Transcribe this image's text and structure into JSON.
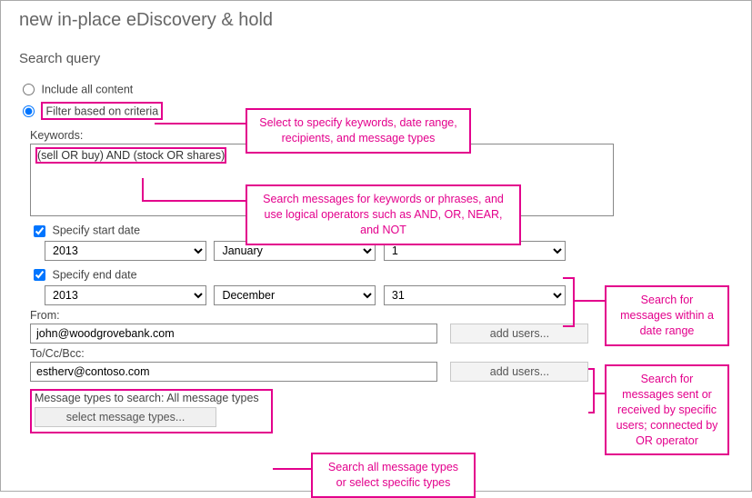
{
  "page_title": "new in-place eDiscovery & hold",
  "section_title": "Search query",
  "radio": {
    "include_all": "Include all content",
    "filter_criteria": "Filter based on criteria"
  },
  "keywords_label": "Keywords:",
  "keywords_value": "(sell OR buy) AND (stock OR shares)",
  "start_date": {
    "label": "Specify start date",
    "year": "2013",
    "month": "January",
    "day": "1"
  },
  "end_date": {
    "label": "Specify end date",
    "year": "2013",
    "month": "December",
    "day": "31"
  },
  "from": {
    "label": "From:",
    "value": "john@woodgrovebank.com",
    "btn": "add users..."
  },
  "tocc": {
    "label": "To/Cc/Bcc:",
    "value": "estherv@contoso.com",
    "btn": "add users..."
  },
  "msg_types": {
    "label": "Message types to search:  All message types",
    "btn": "select message types..."
  },
  "callouts": {
    "criteria": "Select to specify keywords, date range, recipients, and message types",
    "keywords": "Search messages for keywords or phrases, and use logical operators such as AND, OR, NEAR, and NOT",
    "dates": "Search for messages within a date range",
    "users": "Search for messages sent or received by specific users; connected by OR operator",
    "types": "Search all message types or select specific types"
  }
}
